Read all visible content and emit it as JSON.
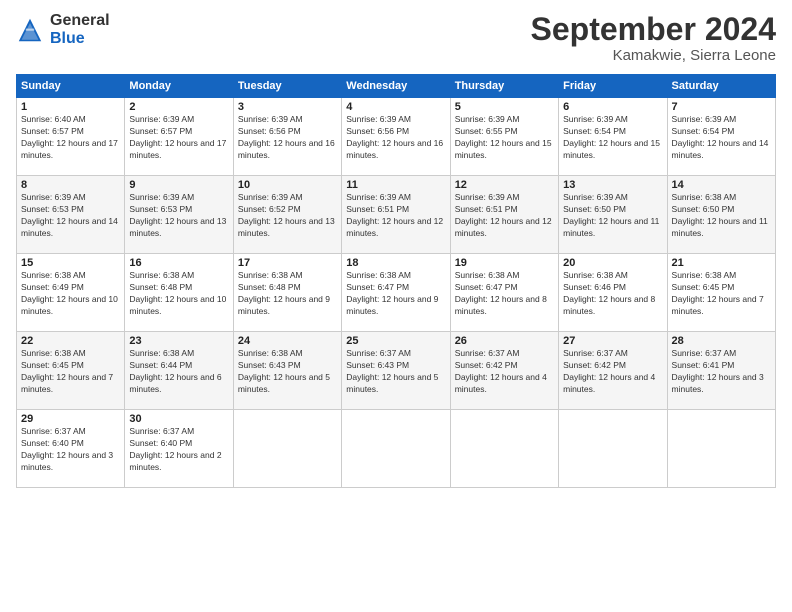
{
  "logo": {
    "general": "General",
    "blue": "Blue"
  },
  "title": "September 2024",
  "location": "Kamakwie, Sierra Leone",
  "days_header": [
    "Sunday",
    "Monday",
    "Tuesday",
    "Wednesday",
    "Thursday",
    "Friday",
    "Saturday"
  ],
  "weeks": [
    [
      {
        "day": "1",
        "sunrise": "6:40 AM",
        "sunset": "6:57 PM",
        "daylight": "12 hours and 17 minutes."
      },
      {
        "day": "2",
        "sunrise": "6:39 AM",
        "sunset": "6:57 PM",
        "daylight": "12 hours and 17 minutes."
      },
      {
        "day": "3",
        "sunrise": "6:39 AM",
        "sunset": "6:56 PM",
        "daylight": "12 hours and 16 minutes."
      },
      {
        "day": "4",
        "sunrise": "6:39 AM",
        "sunset": "6:56 PM",
        "daylight": "12 hours and 16 minutes."
      },
      {
        "day": "5",
        "sunrise": "6:39 AM",
        "sunset": "6:55 PM",
        "daylight": "12 hours and 15 minutes."
      },
      {
        "day": "6",
        "sunrise": "6:39 AM",
        "sunset": "6:54 PM",
        "daylight": "12 hours and 15 minutes."
      },
      {
        "day": "7",
        "sunrise": "6:39 AM",
        "sunset": "6:54 PM",
        "daylight": "12 hours and 14 minutes."
      }
    ],
    [
      {
        "day": "8",
        "sunrise": "6:39 AM",
        "sunset": "6:53 PM",
        "daylight": "12 hours and 14 minutes."
      },
      {
        "day": "9",
        "sunrise": "6:39 AM",
        "sunset": "6:53 PM",
        "daylight": "12 hours and 13 minutes."
      },
      {
        "day": "10",
        "sunrise": "6:39 AM",
        "sunset": "6:52 PM",
        "daylight": "12 hours and 13 minutes."
      },
      {
        "day": "11",
        "sunrise": "6:39 AM",
        "sunset": "6:51 PM",
        "daylight": "12 hours and 12 minutes."
      },
      {
        "day": "12",
        "sunrise": "6:39 AM",
        "sunset": "6:51 PM",
        "daylight": "12 hours and 12 minutes."
      },
      {
        "day": "13",
        "sunrise": "6:39 AM",
        "sunset": "6:50 PM",
        "daylight": "12 hours and 11 minutes."
      },
      {
        "day": "14",
        "sunrise": "6:38 AM",
        "sunset": "6:50 PM",
        "daylight": "12 hours and 11 minutes."
      }
    ],
    [
      {
        "day": "15",
        "sunrise": "6:38 AM",
        "sunset": "6:49 PM",
        "daylight": "12 hours and 10 minutes."
      },
      {
        "day": "16",
        "sunrise": "6:38 AM",
        "sunset": "6:48 PM",
        "daylight": "12 hours and 10 minutes."
      },
      {
        "day": "17",
        "sunrise": "6:38 AM",
        "sunset": "6:48 PM",
        "daylight": "12 hours and 9 minutes."
      },
      {
        "day": "18",
        "sunrise": "6:38 AM",
        "sunset": "6:47 PM",
        "daylight": "12 hours and 9 minutes."
      },
      {
        "day": "19",
        "sunrise": "6:38 AM",
        "sunset": "6:47 PM",
        "daylight": "12 hours and 8 minutes."
      },
      {
        "day": "20",
        "sunrise": "6:38 AM",
        "sunset": "6:46 PM",
        "daylight": "12 hours and 8 minutes."
      },
      {
        "day": "21",
        "sunrise": "6:38 AM",
        "sunset": "6:45 PM",
        "daylight": "12 hours and 7 minutes."
      }
    ],
    [
      {
        "day": "22",
        "sunrise": "6:38 AM",
        "sunset": "6:45 PM",
        "daylight": "12 hours and 7 minutes."
      },
      {
        "day": "23",
        "sunrise": "6:38 AM",
        "sunset": "6:44 PM",
        "daylight": "12 hours and 6 minutes."
      },
      {
        "day": "24",
        "sunrise": "6:38 AM",
        "sunset": "6:43 PM",
        "daylight": "12 hours and 5 minutes."
      },
      {
        "day": "25",
        "sunrise": "6:37 AM",
        "sunset": "6:43 PM",
        "daylight": "12 hours and 5 minutes."
      },
      {
        "day": "26",
        "sunrise": "6:37 AM",
        "sunset": "6:42 PM",
        "daylight": "12 hours and 4 minutes."
      },
      {
        "day": "27",
        "sunrise": "6:37 AM",
        "sunset": "6:42 PM",
        "daylight": "12 hours and 4 minutes."
      },
      {
        "day": "28",
        "sunrise": "6:37 AM",
        "sunset": "6:41 PM",
        "daylight": "12 hours and 3 minutes."
      }
    ],
    [
      {
        "day": "29",
        "sunrise": "6:37 AM",
        "sunset": "6:40 PM",
        "daylight": "12 hours and 3 minutes."
      },
      {
        "day": "30",
        "sunrise": "6:37 AM",
        "sunset": "6:40 PM",
        "daylight": "12 hours and 2 minutes."
      },
      null,
      null,
      null,
      null,
      null
    ]
  ]
}
